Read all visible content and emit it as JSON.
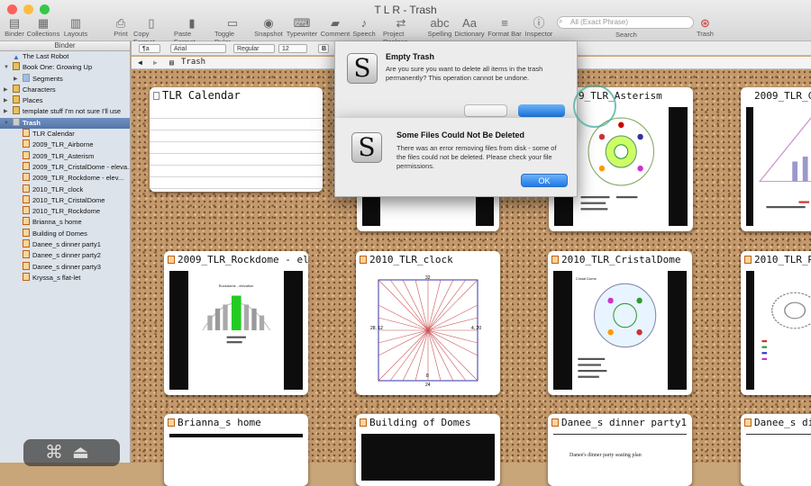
{
  "window": {
    "title": "T L R - Trash"
  },
  "toolbar": {
    "items": [
      {
        "label": "Binder",
        "icon": "binder-icon",
        "glyph": "▤"
      },
      {
        "label": "Collections",
        "icon": "collections-icon",
        "glyph": "▦"
      },
      {
        "label": "Layouts",
        "icon": "layouts-icon",
        "glyph": "▥"
      },
      {
        "label": "Print",
        "icon": "print-icon",
        "glyph": "⎙"
      },
      {
        "label": "Copy Format",
        "icon": "copy-format-icon",
        "glyph": "▯"
      },
      {
        "label": "Paste Format",
        "icon": "paste-format-icon",
        "glyph": "▮"
      },
      {
        "label": "Toggle Ruler",
        "icon": "ruler-icon",
        "glyph": "▭"
      },
      {
        "label": "Snapshot",
        "icon": "snapshot-icon",
        "glyph": "◉"
      },
      {
        "label": "Typewriter",
        "icon": "typewriter-icon",
        "glyph": "⌨"
      },
      {
        "label": "Comment",
        "icon": "comment-icon",
        "glyph": "▰"
      },
      {
        "label": "Speech",
        "icon": "speech-icon",
        "glyph": "♪"
      },
      {
        "label": "Project Replace",
        "icon": "project-replace-icon",
        "glyph": "⇄"
      },
      {
        "label": "Spelling",
        "icon": "spelling-icon",
        "glyph": "abc"
      },
      {
        "label": "Dictionary",
        "icon": "dictionary-icon",
        "glyph": "Aa"
      },
      {
        "label": "Format Bar",
        "icon": "format-bar-icon",
        "glyph": "≡"
      },
      {
        "label": "Inspector",
        "icon": "inspector-icon",
        "glyph": "ⓘ"
      }
    ],
    "search_placeholder": "All (Exact Phrase)",
    "search_label": "Search",
    "trash_label": "Trash"
  },
  "binder": {
    "header": "Binder",
    "items": [
      {
        "label": "The Last Robot",
        "indent": 0,
        "tri": "",
        "selected": false
      },
      {
        "label": "Book One: Growing Up",
        "indent": 0,
        "tri": "▼",
        "selected": false
      },
      {
        "label": "Segments",
        "indent": 1,
        "tri": "▶",
        "selected": false
      },
      {
        "label": "Characters",
        "indent": 0,
        "tri": "▶",
        "selected": false
      },
      {
        "label": "Places",
        "indent": 0,
        "tri": "▶",
        "selected": false
      },
      {
        "label": "template stuff I'm not sure I'll use",
        "indent": 0,
        "tri": "▶",
        "selected": false
      },
      {
        "label": "Trash",
        "indent": 0,
        "tri": "▼",
        "selected": true
      },
      {
        "label": "TLR Calendar",
        "indent": 1,
        "tri": "",
        "selected": false
      },
      {
        "label": "2009_TLR_Airborne",
        "indent": 1,
        "tri": "",
        "selected": false
      },
      {
        "label": "2009_TLR_Asterism",
        "indent": 1,
        "tri": "",
        "selected": false
      },
      {
        "label": "2009_TLR_CristalDome - eleva...",
        "indent": 1,
        "tri": "",
        "selected": false
      },
      {
        "label": "2009_TLR_Rockdome - elev...",
        "indent": 1,
        "tri": "",
        "selected": false
      },
      {
        "label": "2010_TLR_clock",
        "indent": 1,
        "tri": "",
        "selected": false
      },
      {
        "label": "2010_TLR_CristalDome",
        "indent": 1,
        "tri": "",
        "selected": false
      },
      {
        "label": "2010_TLR_Rockdome",
        "indent": 1,
        "tri": "",
        "selected": false
      },
      {
        "label": "Brianna_s home",
        "indent": 1,
        "tri": "",
        "selected": false
      },
      {
        "label": "Building of Domes",
        "indent": 1,
        "tri": "",
        "selected": false
      },
      {
        "label": "Danee_s dinner party1",
        "indent": 1,
        "tri": "",
        "selected": false
      },
      {
        "label": "Danee_s dinner party2",
        "indent": 1,
        "tri": "",
        "selected": false
      },
      {
        "label": "Danee_s dinner party3",
        "indent": 1,
        "tri": "",
        "selected": false
      },
      {
        "label": "Kryssa_s flat-let",
        "indent": 1,
        "tri": "",
        "selected": false
      }
    ]
  },
  "formatbar": {
    "style": "¶a",
    "font": "Arial",
    "weight": "Regular",
    "size": "12",
    "bold": "B"
  },
  "path": {
    "label": "Trash"
  },
  "cards": [
    {
      "title": "TLR Calendar",
      "kind": "lines"
    },
    {
      "title": "9_TLR_Asterism",
      "kind": "image"
    },
    {
      "title": "2009_TLR_Crist",
      "kind": "image"
    },
    {
      "title": "2009_TLR_Rockdome - elevation",
      "kind": "image",
      "caption": "Rockdome - elevation"
    },
    {
      "title": "2010_TLR_clock",
      "kind": "clock",
      "n": "32",
      "e": "4, 20",
      "w": "28, 12",
      "s": "8",
      "s2": "24"
    },
    {
      "title": "2010_TLR_CristalDome",
      "kind": "image",
      "caption": "Cristal Dome"
    },
    {
      "title": "2010_TLR_R",
      "kind": "image"
    },
    {
      "title": "Brianna_s home",
      "kind": "image"
    },
    {
      "title": "Building of Domes",
      "kind": "image"
    },
    {
      "title": "Danee_s dinner party1",
      "kind": "doc",
      "caption": "Danee's dinner party seating plan"
    },
    {
      "title": "Danee_s dinner party",
      "kind": "doc"
    }
  ],
  "dialog_empty": {
    "title": "Empty Trash",
    "message": "Are you sure you want to delete all items in the trash permanently? This operation cannot be undone."
  },
  "dialog_error": {
    "title": "Some Files Could Not Be Deleted",
    "message": "There was an error removing files from disk - some of the files could not be deleted. Please check your file permissions.",
    "ok": "OK"
  },
  "colors": {
    "accent": "#1e7ae8",
    "selection": "#5476ab",
    "cork": "#c49a6c"
  }
}
